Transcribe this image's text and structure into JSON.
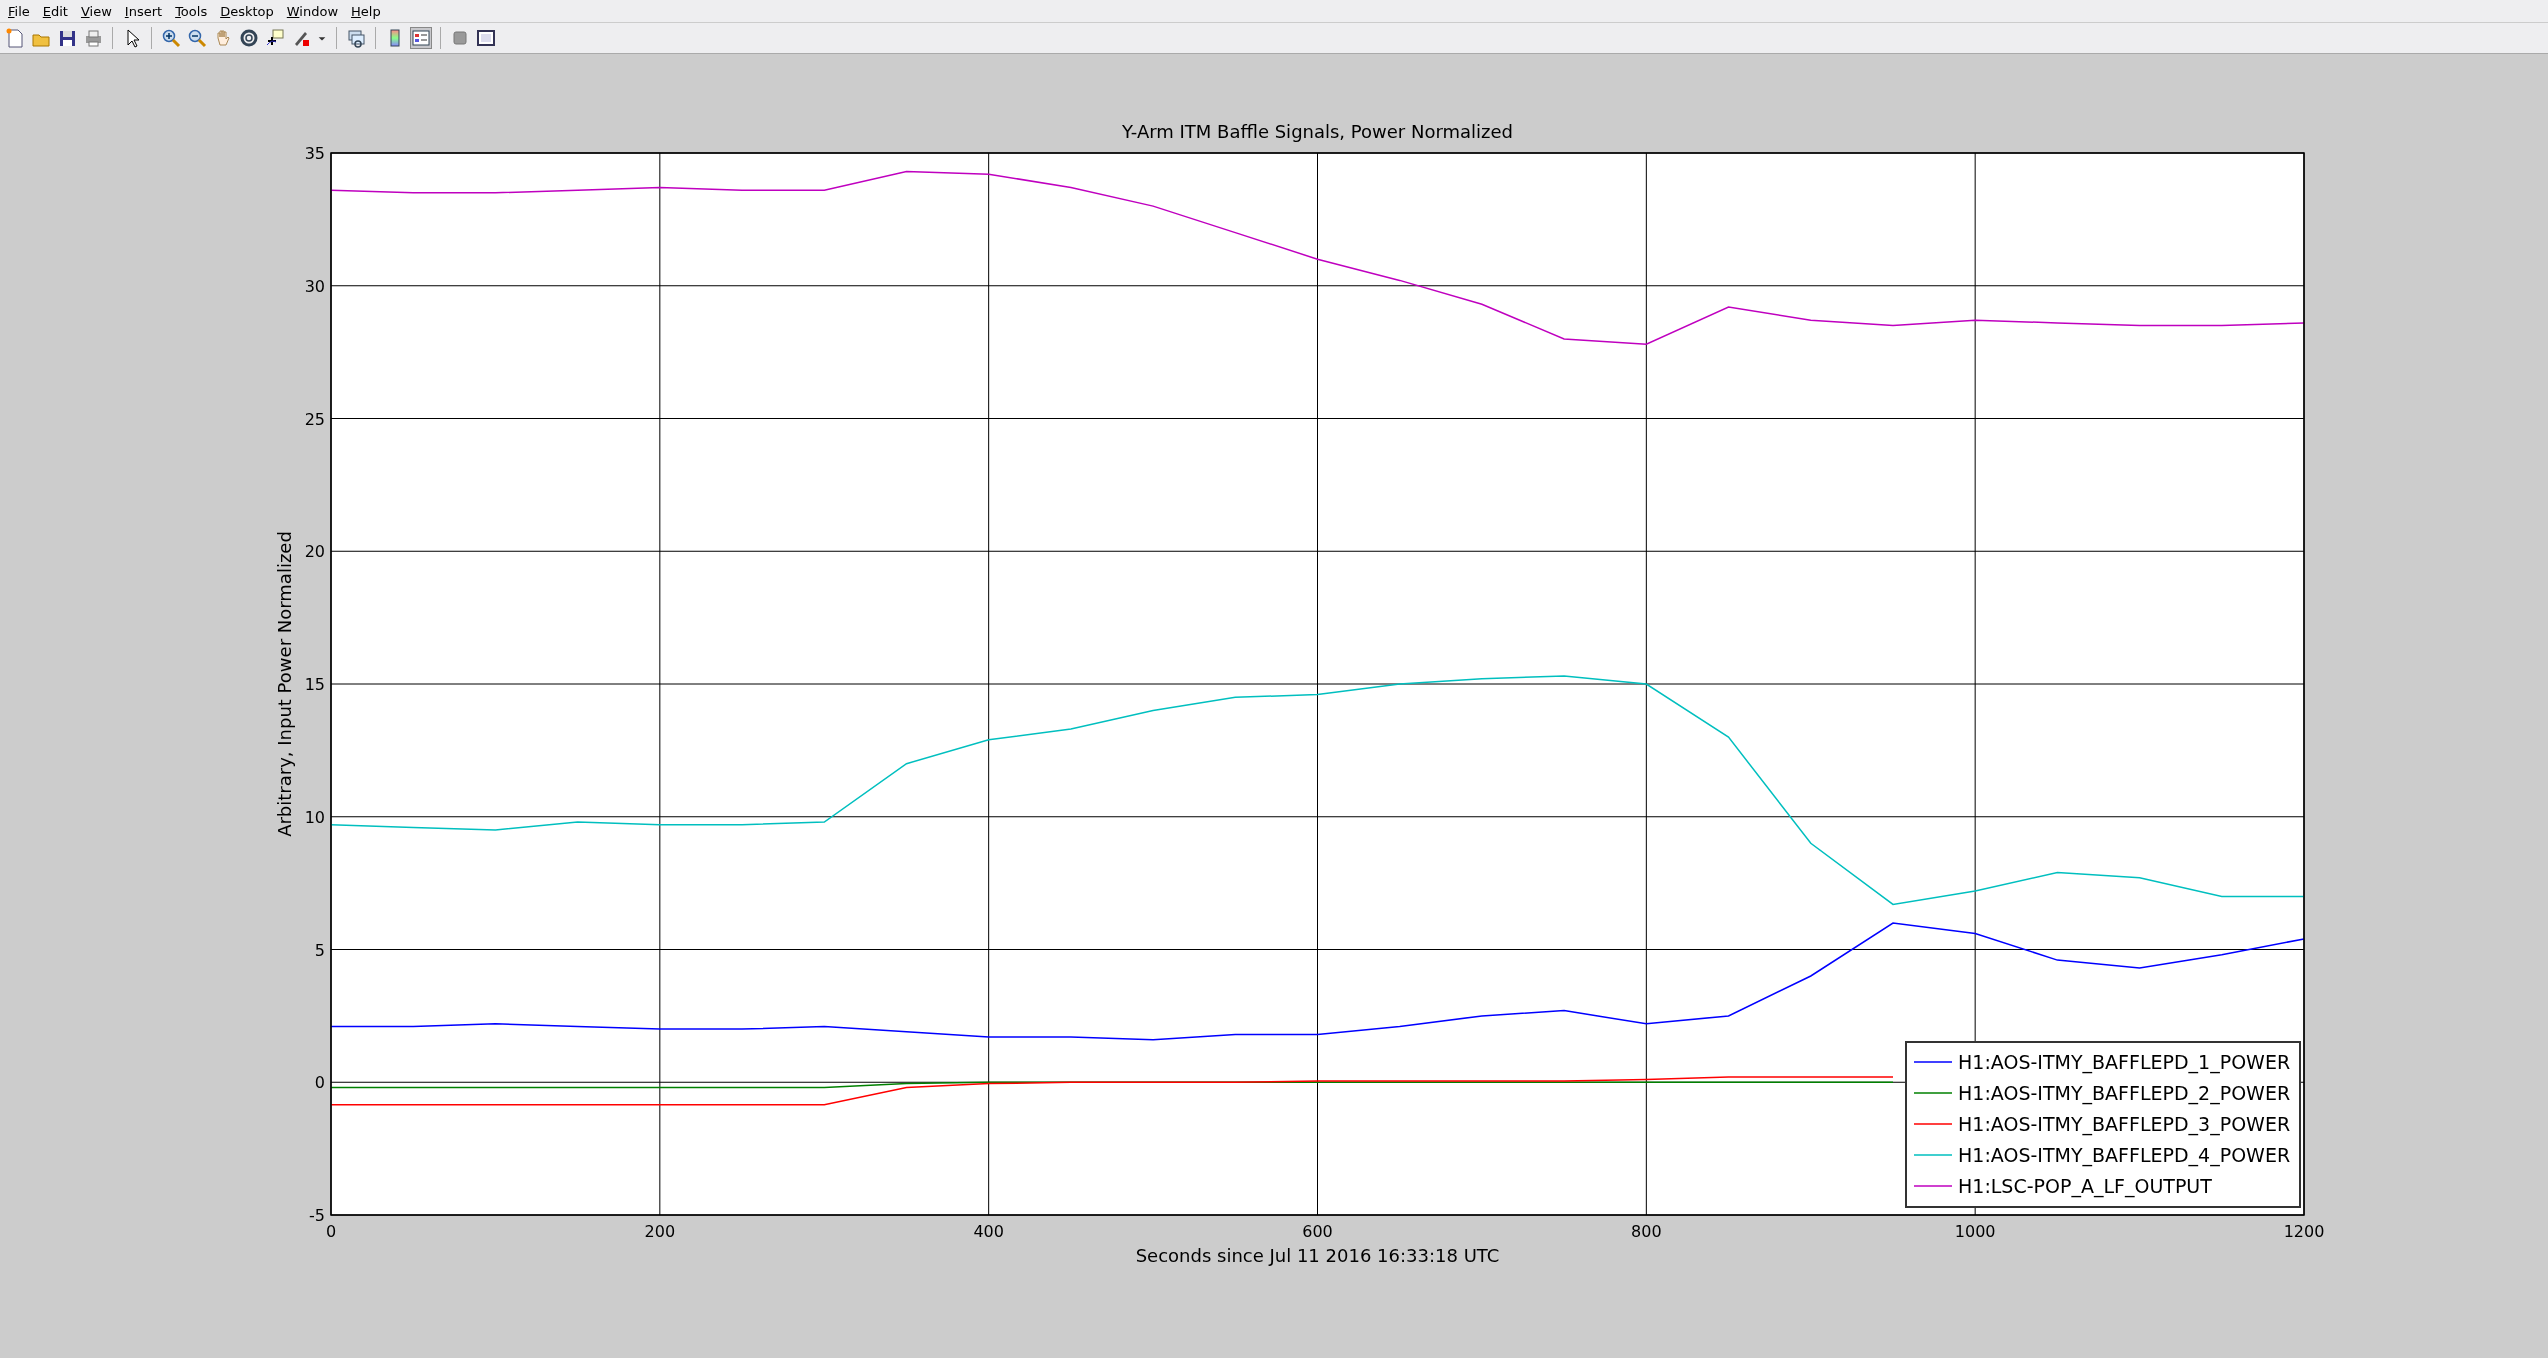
{
  "menu": [
    {
      "label": "File"
    },
    {
      "label": "Edit"
    },
    {
      "label": "View"
    },
    {
      "label": "Insert"
    },
    {
      "label": "Tools"
    },
    {
      "label": "Desktop"
    },
    {
      "label": "Window"
    },
    {
      "label": "Help"
    }
  ],
  "toolbar_toggles": [
    {
      "kind": "colorbar",
      "selected": false
    },
    {
      "kind": "legend",
      "selected": true
    }
  ],
  "plot": {
    "chart_data": {
      "type": "line",
      "title": "Y-Arm ITM Baffle Signals, Power Normalized",
      "xlabel": "Seconds since Jul 11 2016 16:33:18 UTC",
      "ylabel": "Arbitrary, Input Power Normalized",
      "x": [
        0,
        50,
        100,
        150,
        200,
        250,
        300,
        350,
        400,
        450,
        500,
        550,
        600,
        650,
        700,
        750,
        800,
        850,
        900,
        950,
        1000,
        1050,
        1100,
        1150,
        1200
      ],
      "series": [
        {
          "name": "H1:AOS-ITMY_BAFFLEPD_1_POWER",
          "color": "#0000ff",
          "values": [
            2.1,
            2.1,
            2.2,
            2.1,
            2.0,
            2.0,
            2.1,
            1.9,
            1.7,
            1.7,
            1.6,
            1.8,
            1.8,
            2.1,
            2.5,
            2.7,
            2.2,
            2.5,
            4.0,
            6.0,
            5.6,
            4.6,
            4.3,
            4.8,
            5.4
          ]
        },
        {
          "name": "H1:AOS-ITMY_BAFFLEPD_2_POWER",
          "color": "#008000",
          "values": [
            -0.2,
            -0.2,
            -0.2,
            -0.2,
            -0.2,
            -0.2,
            -0.2,
            -0.05,
            0,
            0,
            0,
            0,
            0,
            0,
            0,
            0,
            0,
            0,
            0,
            0,
            null,
            null,
            null,
            null,
            null
          ]
        },
        {
          "name": "H1:AOS-ITMY_BAFFLEPD_3_POWER",
          "color": "#ff0000",
          "values": [
            -0.85,
            -0.85,
            -0.85,
            -0.85,
            -0.85,
            -0.85,
            -0.85,
            -0.2,
            -0.05,
            0,
            0,
            0,
            0.05,
            0.05,
            0.05,
            0.05,
            0.1,
            0.2,
            0.2,
            0.2,
            null,
            null,
            null,
            null,
            null
          ]
        },
        {
          "name": "H1:AOS-ITMY_BAFFLEPD_4_POWER",
          "color": "#00bfbf",
          "values": [
            9.7,
            9.6,
            9.5,
            9.8,
            9.7,
            9.7,
            9.8,
            12.0,
            12.9,
            13.3,
            14.0,
            14.5,
            14.6,
            15.0,
            15.2,
            15.3,
            15.0,
            13.0,
            9.0,
            6.7,
            7.2,
            7.9,
            7.7,
            7.0,
            7.0
          ]
        },
        {
          "name": "H1:LSC-POP_A_LF_OUTPUT",
          "color": "#bf00bf",
          "values": [
            33.6,
            33.5,
            33.5,
            33.6,
            33.7,
            33.6,
            33.6,
            34.3,
            34.2,
            33.7,
            33.0,
            32.0,
            31.0,
            30.2,
            29.3,
            28.0,
            27.8,
            29.2,
            28.7,
            28.5,
            28.7,
            28.6,
            28.5,
            28.5,
            28.6
          ]
        }
      ],
      "xlim": [
        0,
        1200
      ],
      "ylim": [
        -5,
        35
      ],
      "xticks": [
        0,
        200,
        400,
        600,
        800,
        1000,
        1200
      ],
      "yticks": [
        -5,
        0,
        5,
        10,
        15,
        20,
        25,
        30,
        35
      ],
      "grid": true,
      "legend": true
    }
  }
}
